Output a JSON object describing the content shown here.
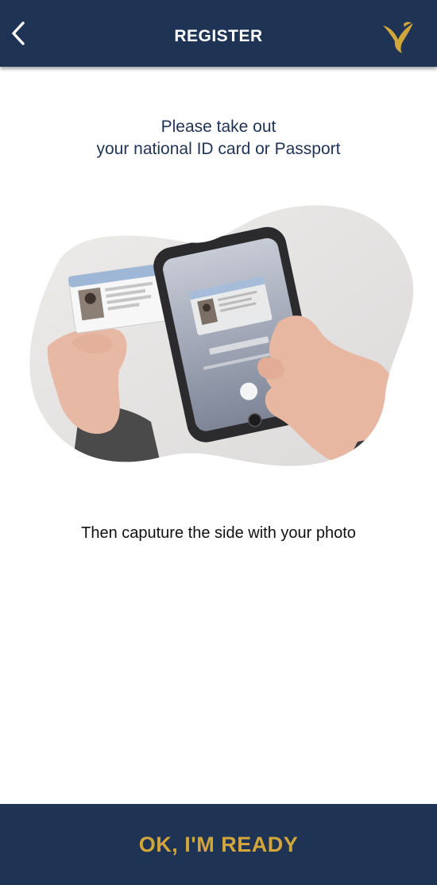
{
  "header": {
    "title": "REGISTER",
    "back_icon": "chevron-left-icon",
    "logo_icon": "bird-logo-icon",
    "background": "#1f3355",
    "logo_color": "#d1a63a"
  },
  "intro": {
    "line1": "Please take out",
    "line2": "your national ID card or Passport"
  },
  "illustration": {
    "icon": "id-scan-illustration"
  },
  "instruction": "Then caputure the side with your photo",
  "footer": {
    "button_label": "OK, I'M READY",
    "label_color": "#d1a63a"
  }
}
